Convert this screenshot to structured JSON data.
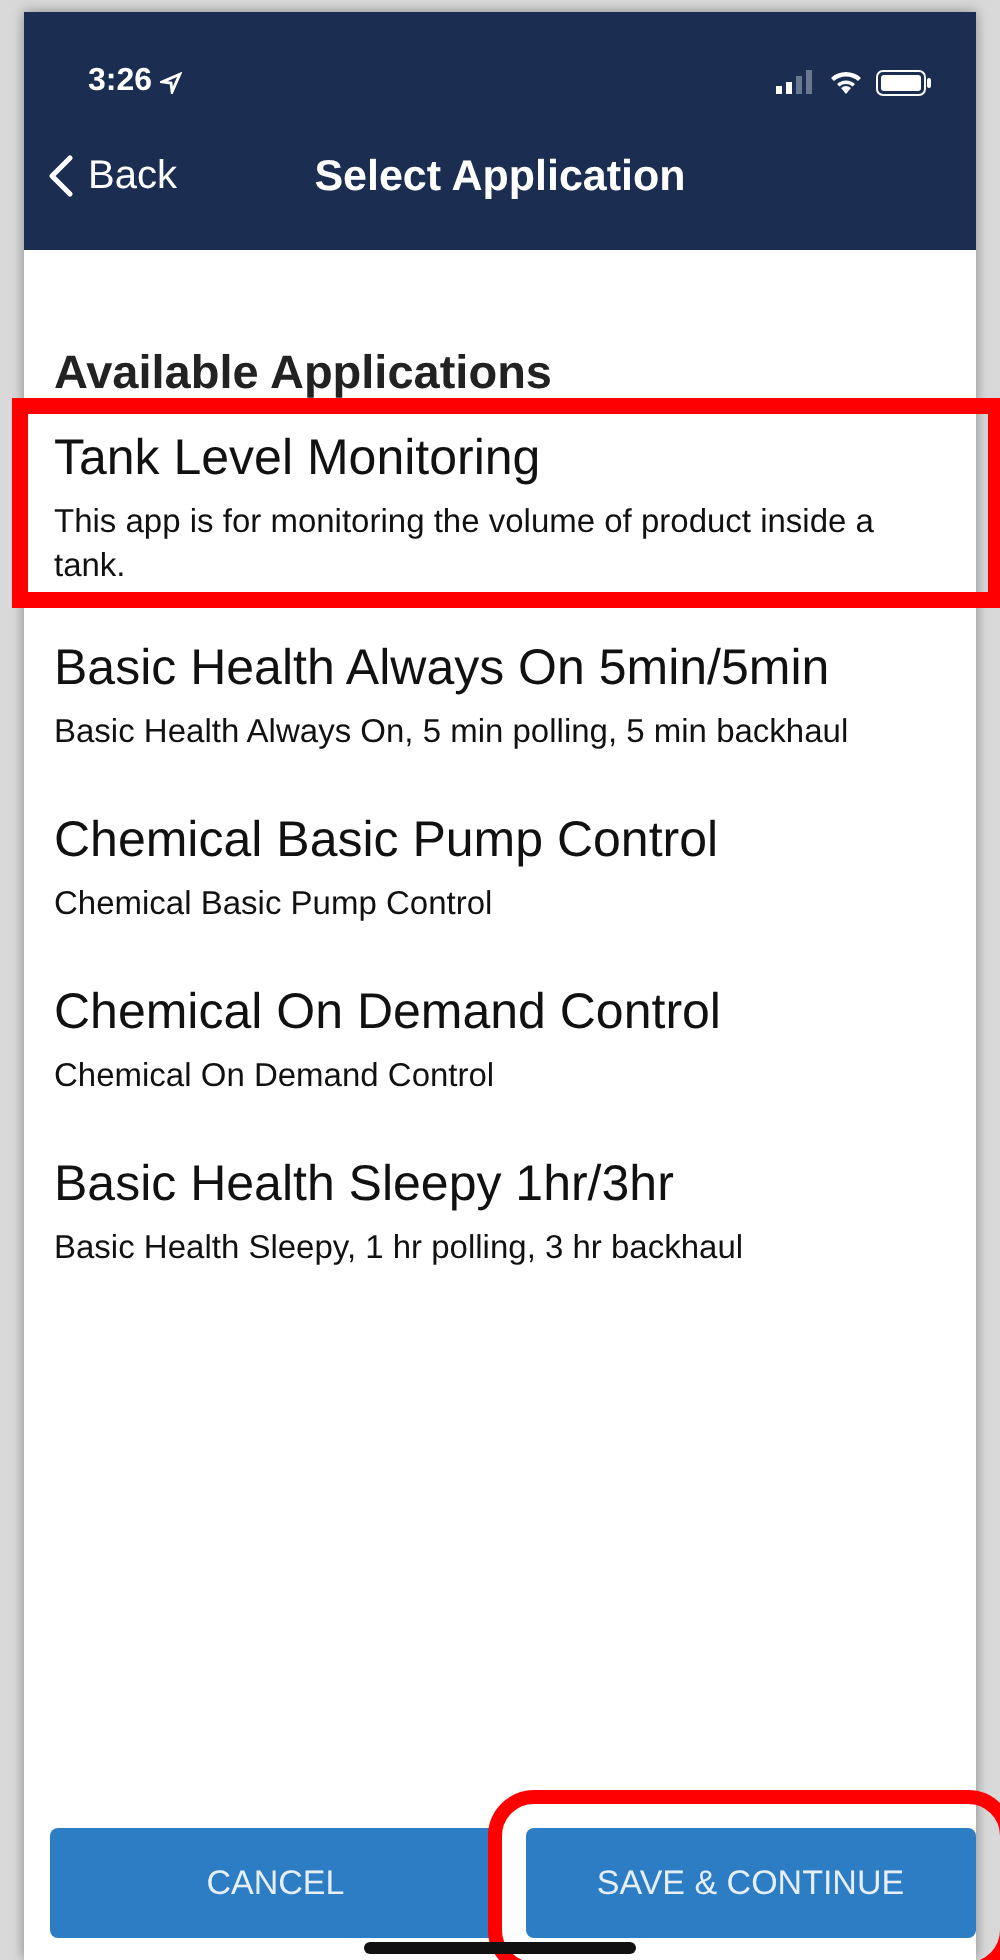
{
  "status_bar": {
    "time": "3:26"
  },
  "nav": {
    "back": "Back",
    "title": "Select Application"
  },
  "section_title": "Available Applications",
  "applications": [
    {
      "name": "Tank Level Monitoring",
      "description": "This app is for monitoring the volume of product inside a tank.",
      "highlighted": true
    },
    {
      "name": "Basic Health Always On 5min/5min",
      "description": "Basic Health Always On, 5 min polling, 5 min backhaul",
      "highlighted": false
    },
    {
      "name": "Chemical Basic Pump Control",
      "description": "Chemical Basic Pump Control",
      "highlighted": false
    },
    {
      "name": "Chemical On Demand Control",
      "description": "Chemical On Demand Control",
      "highlighted": false
    },
    {
      "name": "Basic Health Sleepy 1hr/3hr",
      "description": "Basic Health Sleepy, 1 hr polling, 3 hr backhaul",
      "highlighted": false
    }
  ],
  "buttons": [
    {
      "label": "CANCEL",
      "highlighted": false
    },
    {
      "label": "SAVE & CONTINUE",
      "highlighted": true
    }
  ]
}
